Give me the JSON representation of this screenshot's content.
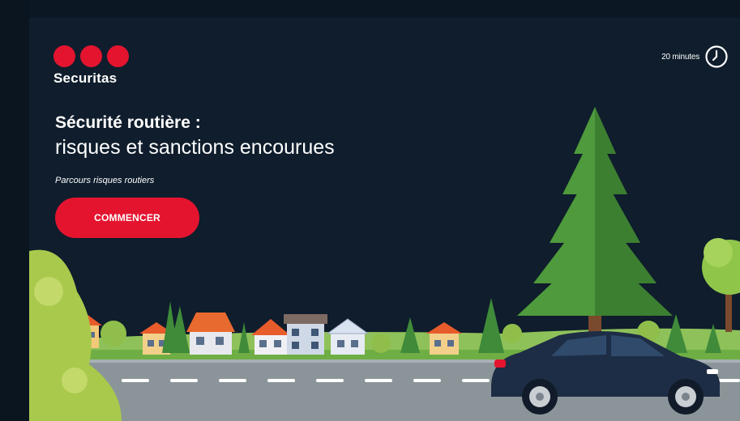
{
  "brand": {
    "name": "Securitas",
    "accent_color": "#e4142f"
  },
  "duration": {
    "text": "20 minutes",
    "icon": "clock-icon"
  },
  "course": {
    "title_line1": "Sécurité routière :",
    "title_line2": "risques et sanctions encourues",
    "subtitle": "Parcours risques routiers",
    "start_label": "COMMENCER"
  },
  "colors": {
    "background": "#0f1d2c",
    "road": "#8c969b",
    "tree": "#4e9a3c",
    "car": "#1d2d45"
  }
}
